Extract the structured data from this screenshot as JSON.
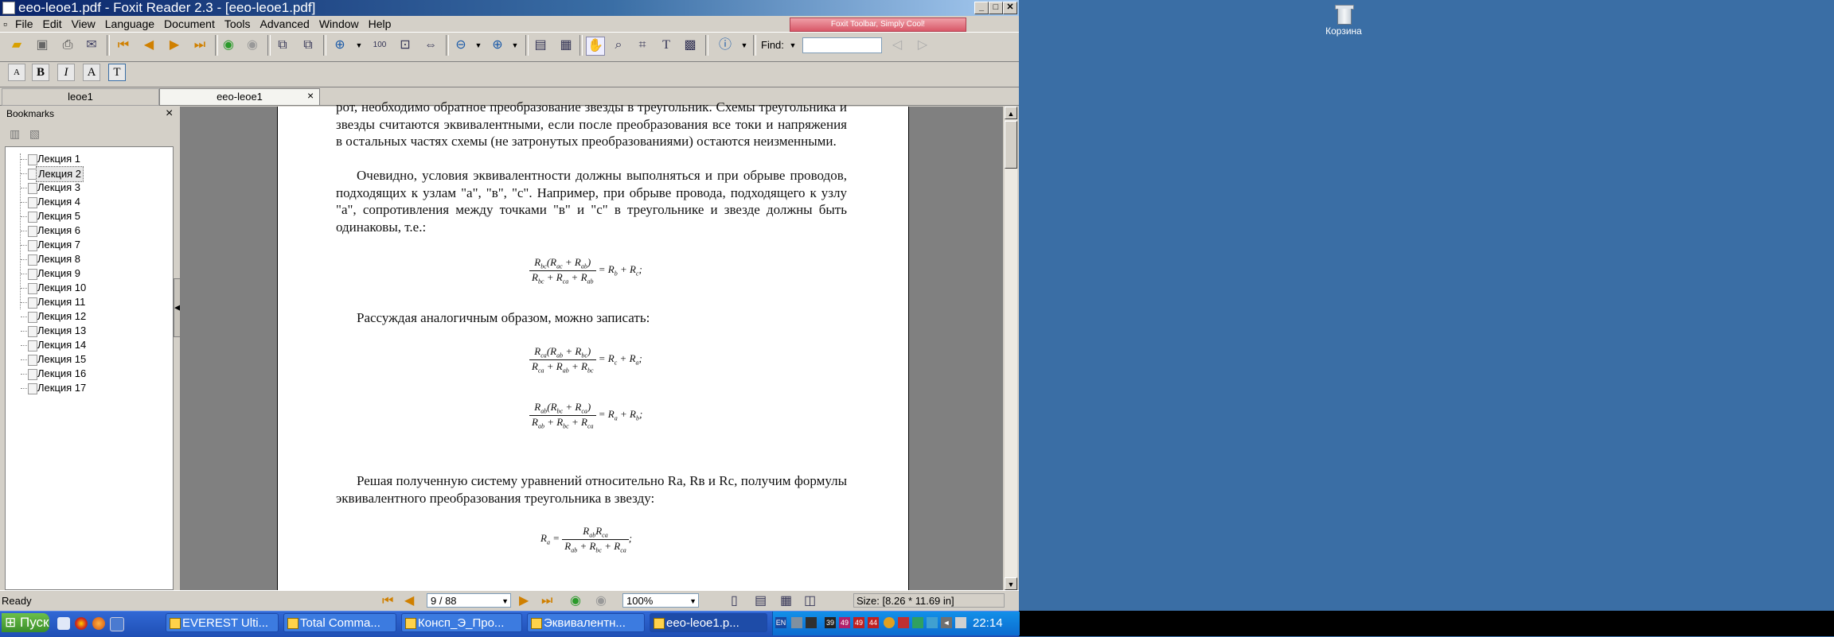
{
  "window": {
    "title": "eeo-leoe1.pdf - Foxit Reader 2.3 - [eeo-leoe1.pdf]"
  },
  "menu": [
    "File",
    "Edit",
    "View",
    "Language",
    "Document",
    "Tools",
    "Advanced",
    "Window",
    "Help"
  ],
  "ad_banner": "Foxit Toolbar, Simply Cool!",
  "find": {
    "label": "Find:",
    "value": ""
  },
  "tabs": [
    "leoe1",
    "eeo-leoe1"
  ],
  "bookmarks": {
    "title": "Bookmarks",
    "items": [
      "Лекция 1",
      "Лекция 2",
      "Лекция 3",
      "Лекция 4",
      "Лекция 5",
      "Лекция 6",
      "Лекция 7",
      "Лекция 8",
      "Лекция 9",
      "Лекция 10",
      "Лекция 11",
      "Лекция 12",
      "Лекция 13",
      "Лекция 14",
      "Лекция 15",
      "Лекция 16",
      "Лекция 17"
    ],
    "selected": "Лекция 2"
  },
  "document": {
    "p1": "рот, необходимо обратное преобразование звезды в треугольник. Схемы треугольника и звезды считаются эквивалентными, если после преобразования все токи и напряжения в остальных частях схемы (не затронутых преобразованиями) остаются неизменными.",
    "p2": "Очевидно, условия эквивалентности должны выполняться и при обрыве проводов, подходящих к узлам \"а\", \"в\", \"с\". Например, при обрыве провода, подходящего к узлу \"а\", сопротивления между точками \"в\" и \"с\" в треугольнике и звезде должны быть одинаковы, т.е.:",
    "p3": "Рассуждая аналогичным образом, можно записать:",
    "p4": "Решая полученную систему уравнений относительно Ra, Rв и Rc, получим формулы эквивалентного преобразования треугольника в звезду:"
  },
  "status": {
    "ready": "Ready",
    "page": "9 / 88",
    "zoom": "100%",
    "size": "Size: [8.26 * 11.69 in]"
  },
  "desktop": {
    "recycle_bin": "Корзина"
  },
  "taskbar": {
    "start": "Пуск",
    "tasks": [
      "EVEREST Ulti...",
      "Total Comma...",
      "Консп_Э_Про...",
      "Эквивалентн...",
      "eeo-leoe1.p..."
    ],
    "tray": [
      "EN",
      "39",
      "49",
      "49",
      "44"
    ],
    "clock": "22:14"
  }
}
